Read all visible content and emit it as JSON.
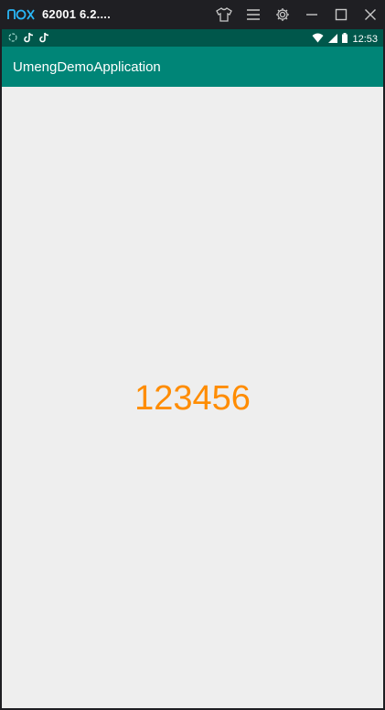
{
  "window": {
    "title": "62001 6.2....",
    "icons": [
      "nox-logo",
      "shirt-icon",
      "menu-icon",
      "gear-icon",
      "minimize-icon",
      "maximize-icon",
      "close-icon"
    ]
  },
  "statusbar": {
    "time": "12:53",
    "left_icons": [
      "sync-icon",
      "tiktok-icon",
      "tiktok-icon"
    ],
    "right_icons": [
      "wifi-icon",
      "signal-icon",
      "battery-icon"
    ]
  },
  "appbar": {
    "title": "UmengDemoApplication"
  },
  "content": {
    "number": "123456"
  },
  "colors": {
    "titlebar": "#1f1f23",
    "statusbar": "#00574b",
    "appbar": "#008577",
    "background": "#eeeeee",
    "number": "#ff8c00"
  }
}
